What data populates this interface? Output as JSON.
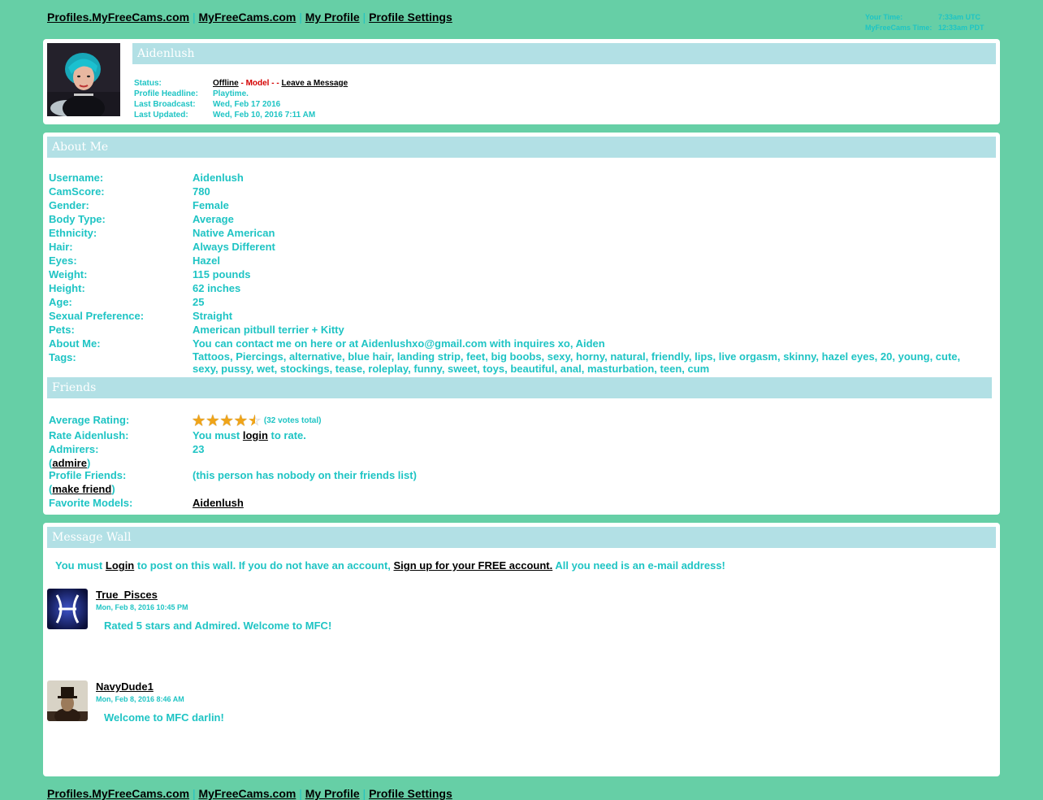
{
  "nav": {
    "links": [
      "Profiles.MyFreeCams.com",
      "MyFreeCams.com",
      "My Profile",
      "Profile Settings"
    ],
    "separator": "|"
  },
  "times": {
    "your_label": "Your Time:",
    "your_value": "7:33am UTC",
    "mfc_label": "MyFreeCams Time:",
    "mfc_value": "12:33am PDT"
  },
  "profile": {
    "name": "Aidenlush",
    "status_label": "Status:",
    "status_value": "Offline",
    "status_dash": " - ",
    "model_label": "Model",
    "dashes": " - - ",
    "leave_message": "Leave a Message",
    "headline_label": "Profile Headline:",
    "headline_value": "Playtime.",
    "last_broadcast_label": "Last Broadcast:",
    "last_broadcast_value": "Wed, Feb 17 2016",
    "last_updated_label": "Last Updated:",
    "last_updated_value": "Wed, Feb 10, 2016 7:11 AM"
  },
  "about": {
    "heading": "About Me",
    "fields": [
      {
        "k": "Username:",
        "v": "Aidenlush"
      },
      {
        "k": "CamScore:",
        "v": "780"
      },
      {
        "k": "Gender:",
        "v": "Female"
      },
      {
        "k": "Body Type:",
        "v": "Average"
      },
      {
        "k": "Ethnicity:",
        "v": "Native American"
      },
      {
        "k": "Hair:",
        "v": "Always Different"
      },
      {
        "k": "Eyes:",
        "v": "Hazel"
      },
      {
        "k": "Weight:",
        "v": "115 pounds"
      },
      {
        "k": "Height:",
        "v": "62 inches"
      },
      {
        "k": "Age:",
        "v": "25"
      },
      {
        "k": "Sexual Preference:",
        "v": "Straight"
      },
      {
        "k": "Pets:",
        "v": "American pitbull terrier + Kitty"
      },
      {
        "k": "About Me:",
        "v": "You can contact me on here or at Aidenlushxo@gmail.com with inquires xo, Aiden"
      },
      {
        "k": "Tags:",
        "v": "Tattoos, Piercings, alternative, blue hair, landing strip, feet, big boobs, sexy, horny, natural, friendly, lips, live orgasm, skinny, hazel eyes, 20, young, cute, sexy, pussy, wet, stockings, tease, roleplay, funny, sweet, toys, beautiful, anal, masturbation, teen, cum"
      }
    ]
  },
  "friends": {
    "heading": "Friends",
    "avg_rating_label": "Average Rating:",
    "rating": 4.5,
    "votes": "(32 votes total)",
    "rate_label": "Rate Aidenlush:",
    "rate_pre": "You must ",
    "rate_link": "login",
    "rate_post": " to rate.",
    "admirers_label": "Admirers:",
    "admirers_value": "23",
    "admire_link": "admire",
    "profile_friends_label": "Profile Friends:",
    "profile_friends_value": "(this person has nobody on their friends list)",
    "make_friend_link": "make friend",
    "favorite_label": "Favorite Models:",
    "favorite_value": "Aidenlush"
  },
  "wall": {
    "heading": "Message Wall",
    "note_pre": "You must ",
    "note_login": "Login",
    "note_mid": " to post on this wall. If you do not have an account, ",
    "note_signup": "Sign up for your FREE account.",
    "note_post": " All you need is an e-mail address!",
    "posts": [
      {
        "author": "True_Pisces",
        "date": "Mon, Feb 8, 2016 10:45 PM",
        "message": "Rated 5 stars and Admired. Welcome to MFC!"
      },
      {
        "author": "NavyDude1",
        "date": "Mon, Feb 8, 2016 8:46 AM",
        "message": "Welcome to MFC darlin!"
      }
    ]
  }
}
